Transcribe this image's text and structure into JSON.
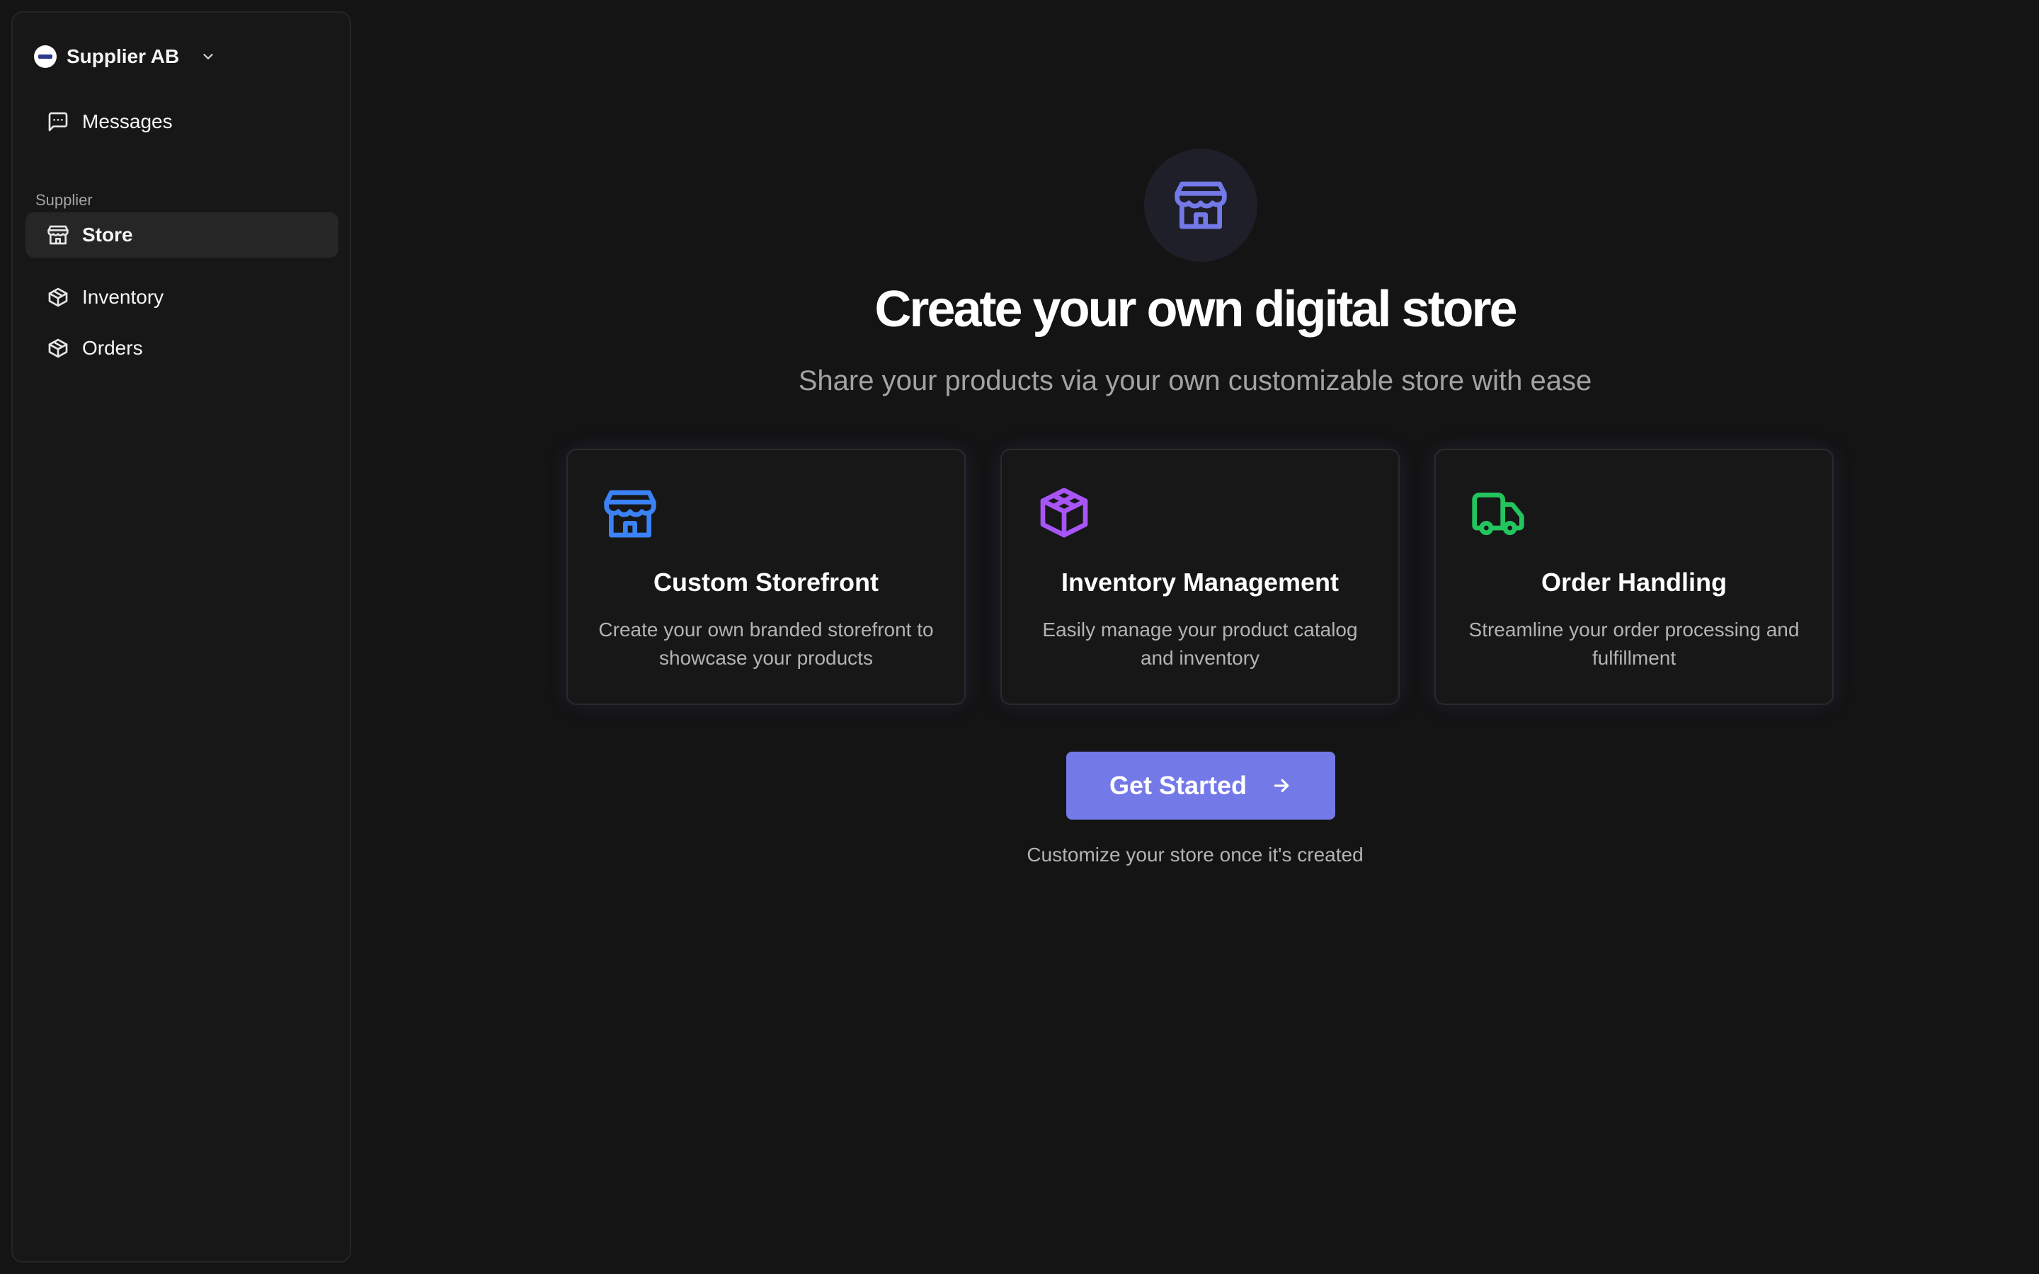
{
  "sidebar": {
    "org_name": "Supplier AB",
    "messages_label": "Messages",
    "section_label": "Supplier",
    "items": [
      {
        "label": "Store",
        "icon": "store-icon",
        "active": true
      },
      {
        "label": "Inventory",
        "icon": "package-icon",
        "active": false
      },
      {
        "label": "Orders",
        "icon": "package-icon",
        "active": false
      }
    ]
  },
  "main": {
    "title": "Create your own digital store",
    "subtitle": "Share your products via your own customizable store with ease",
    "features": [
      {
        "title": "Custom Storefront",
        "description": "Create your own branded storefront to showcase your products",
        "icon": "store-icon",
        "color": "#3b82f6"
      },
      {
        "title": "Inventory Management",
        "description": "Easily manage your product catalog and inventory",
        "icon": "boxes-icon",
        "color": "#a855f7"
      },
      {
        "title": "Order Handling",
        "description": "Streamline your order processing and fulfillment",
        "icon": "truck-icon",
        "color": "#22c55e"
      }
    ],
    "cta_label": "Get Started",
    "cta_hint": "Customize your store once it's created"
  },
  "colors": {
    "accent": "#7479e8",
    "background": "#141414",
    "sidebar_bg": "#171717"
  }
}
